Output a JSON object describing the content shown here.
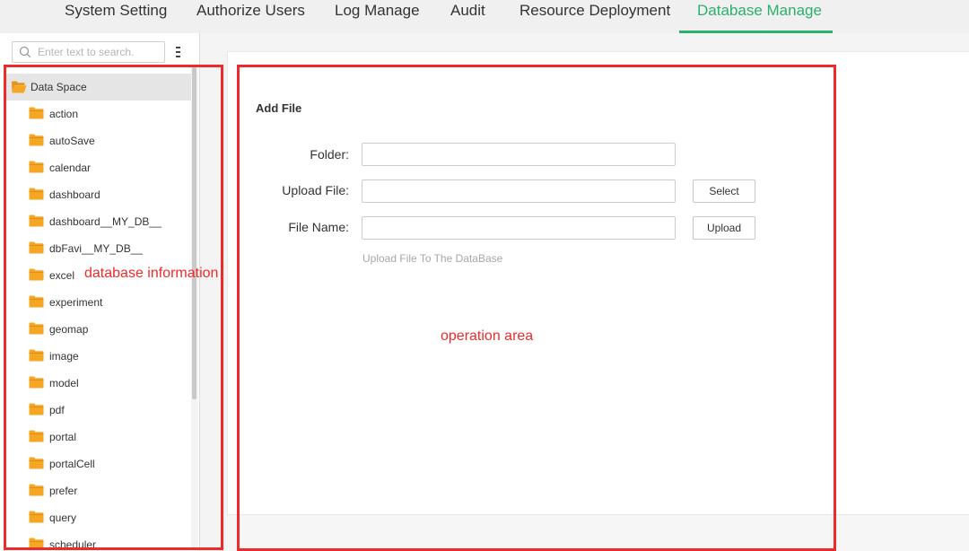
{
  "tabs": [
    {
      "label": "System Setting"
    },
    {
      "label": "Authorize Users"
    },
    {
      "label": "Log Manage"
    },
    {
      "label": "Audit"
    },
    {
      "label": "Resource Deployment"
    },
    {
      "label": "Database Manage",
      "active": true
    }
  ],
  "colors": {
    "accent": "#2bb06a",
    "folder": "#f5a623",
    "annotation": "#ee2a2a"
  },
  "search": {
    "placeholder": "Enter text to search.",
    "value": ""
  },
  "tree": {
    "root": {
      "label": "Data Space",
      "icon": "folder-open-icon"
    },
    "items": [
      {
        "label": "action"
      },
      {
        "label": "autoSave"
      },
      {
        "label": "calendar"
      },
      {
        "label": "dashboard"
      },
      {
        "label": "dashboard__MY_DB__"
      },
      {
        "label": "dbFavi__MY_DB__"
      },
      {
        "label": "excel"
      },
      {
        "label": "experiment"
      },
      {
        "label": "geomap"
      },
      {
        "label": "image"
      },
      {
        "label": "model"
      },
      {
        "label": "pdf"
      },
      {
        "label": "portal"
      },
      {
        "label": "portalCell"
      },
      {
        "label": "prefer"
      },
      {
        "label": "query"
      },
      {
        "label": "scheduler"
      }
    ]
  },
  "form": {
    "title": "Add File",
    "folder_label": "Folder:",
    "folder_value": "",
    "upload_label": "Upload File:",
    "upload_value": "",
    "select_button": "Select",
    "filename_label": "File Name:",
    "filename_value": "",
    "upload_button": "Upload",
    "hint": "Upload File To The DataBase"
  },
  "annotations": {
    "left": "database information",
    "right": "operation area"
  }
}
